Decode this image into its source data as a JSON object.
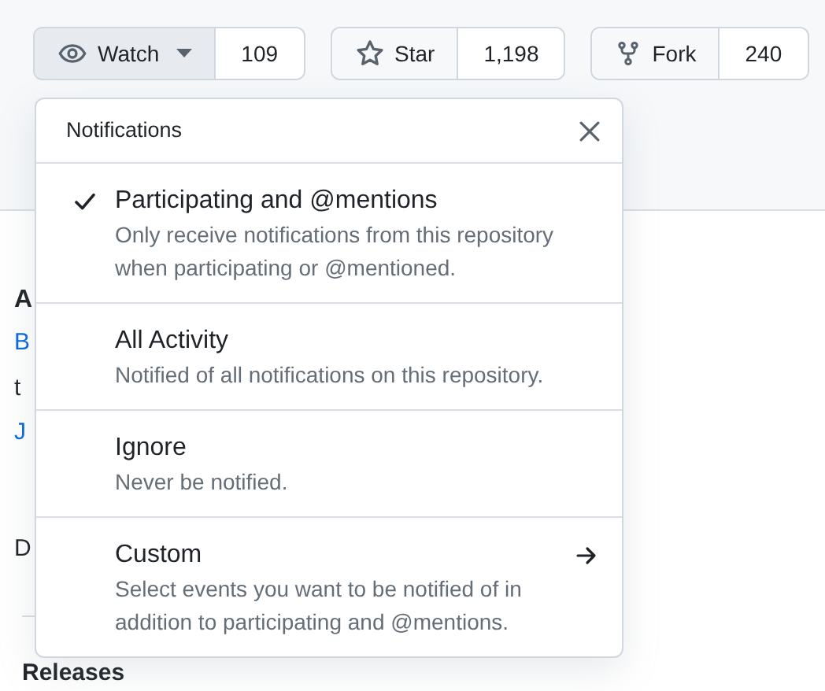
{
  "buttons": [
    {
      "kind": "watch",
      "label": "Watch",
      "count": "109",
      "pressed": true,
      "menu": true
    },
    {
      "kind": "star",
      "label": "Star",
      "count": "1,198",
      "pressed": false,
      "menu": false
    },
    {
      "kind": "fork",
      "label": "Fork",
      "count": "240",
      "pressed": false,
      "menu": false
    }
  ],
  "background": {
    "fragments": [
      {
        "kind": "heading",
        "text": "A"
      },
      {
        "kind": "link",
        "text": "B"
      },
      {
        "kind": "text",
        "text": "t"
      },
      {
        "kind": "link",
        "text": "J"
      },
      {
        "kind": "text",
        "text": "D"
      }
    ],
    "releases_heading": "Releases"
  },
  "notifications": {
    "title": "Notifications",
    "options": [
      {
        "kind": "option",
        "label": "Participating and @mentions",
        "description": "Only receive notifications from this repository when participating or @mentioned.",
        "selected": true
      },
      {
        "kind": "option",
        "label": "All Activity",
        "description": "Notified of all notifications on this repository.",
        "selected": false
      },
      {
        "kind": "option",
        "label": "Ignore",
        "description": "Never be notified.",
        "selected": false
      },
      {
        "kind": "submenu",
        "label": "Custom",
        "description": "Select events you want to be notified of in addition to participating and @mentions.",
        "selected": false
      }
    ]
  }
}
